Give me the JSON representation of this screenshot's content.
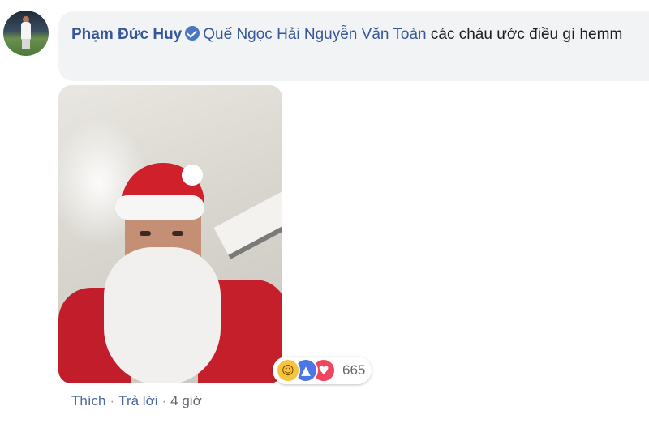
{
  "comment": {
    "author": "Phạm Đức Huy",
    "mention_1": "Quế Ngọc Hải",
    "mention_2": "Nguyễn Văn Toàn",
    "text": "các cháu ước điều gì hemm"
  },
  "icons": {
    "verified": "verified-badge-icon",
    "reaction_1": "haha-icon",
    "reaction_2": "like-icon",
    "reaction_3": "love-icon"
  },
  "reactions": {
    "count": "665"
  },
  "actions": {
    "like_label": "Thích",
    "reply_label": "Trả lời",
    "separator": "·",
    "time": "4 giờ"
  },
  "colors": {
    "link": "#365899",
    "bubble": "#f2f3f5",
    "verified": "#4a76c2"
  }
}
